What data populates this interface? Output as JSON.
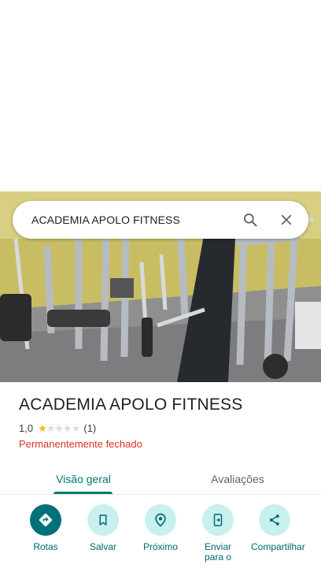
{
  "search": {
    "query": "ACADEMIA APOLO FITNESS"
  },
  "place": {
    "name": "ACADEMIA APOLO FITNESS",
    "rating": "1,0",
    "stars": 1,
    "stars_max": 5,
    "review_count": "(1)",
    "status": "Permanentemente fechado"
  },
  "tabs": [
    {
      "label": "Visão geral",
      "active": true
    },
    {
      "label": "Avaliações",
      "active": false
    }
  ],
  "actions": [
    {
      "label": "Rotas",
      "icon": "directions-icon"
    },
    {
      "label": "Salvar",
      "icon": "bookmark-icon"
    },
    {
      "label": "Próximo",
      "icon": "nearby-icon"
    },
    {
      "label": "Enviar para o",
      "icon": "send-to-phone-icon"
    },
    {
      "label": "Compartilhar",
      "icon": "share-icon"
    }
  ],
  "colors": {
    "accent": "#00796b",
    "status_closed": "#d93025",
    "star": "#fbbc04",
    "action_bg": "#c8f0ef"
  }
}
